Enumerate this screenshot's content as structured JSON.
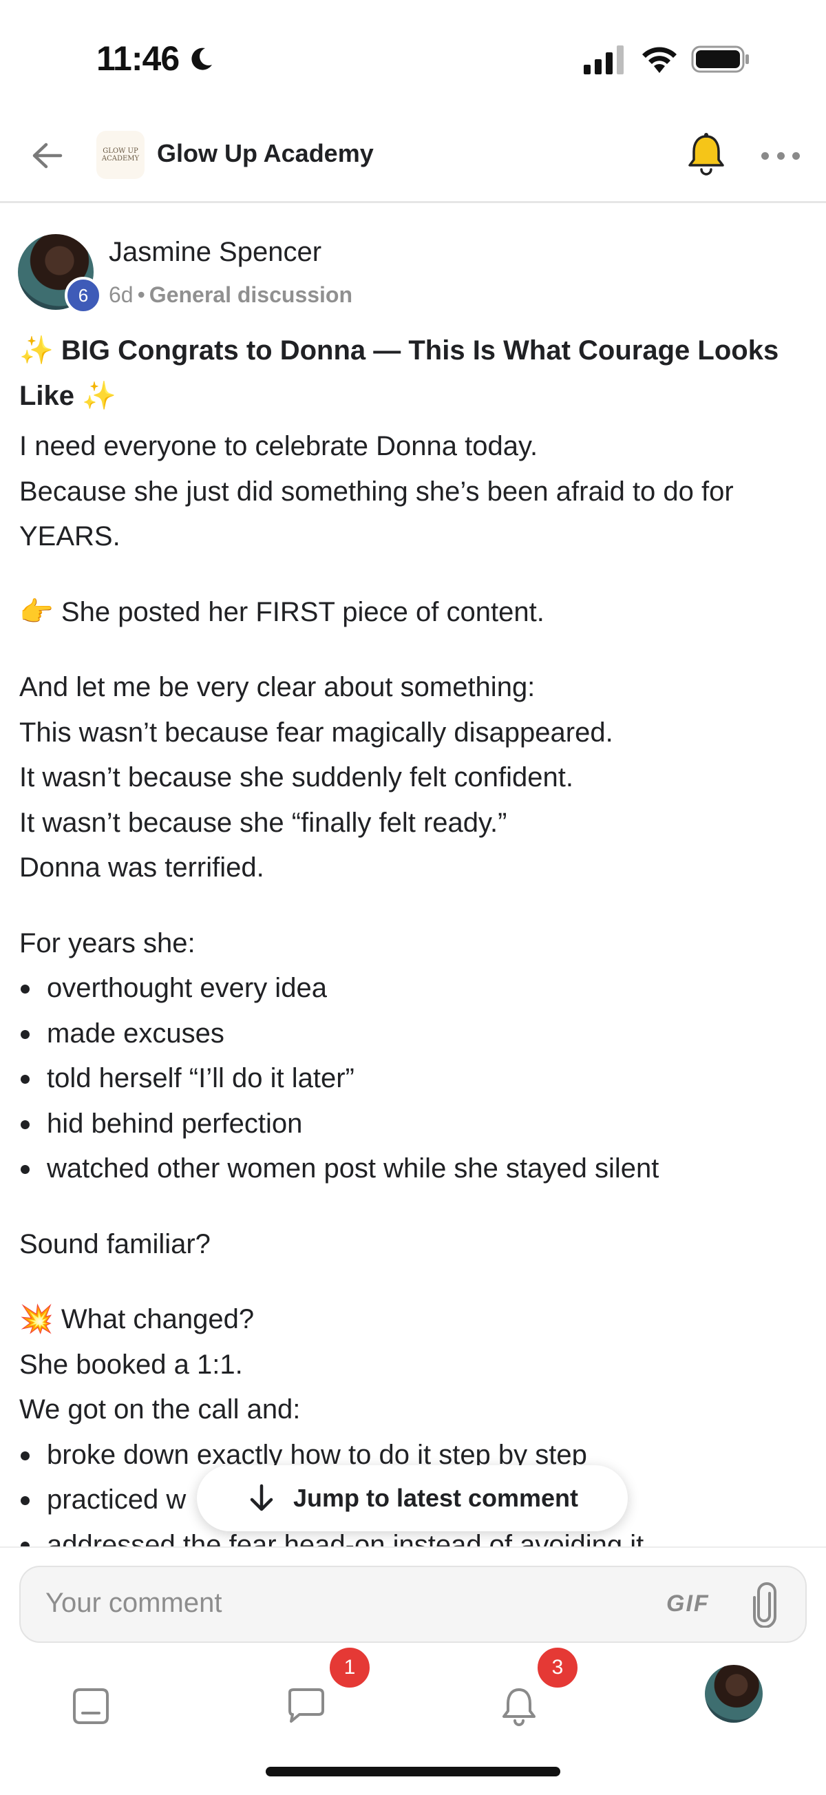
{
  "status_bar": {
    "time": "11:46"
  },
  "header": {
    "group_logo_text": "GLOW UP ACADEMY",
    "group_name": "Glow Up Academy"
  },
  "post": {
    "author": "Jasmine Spencer",
    "level": "6",
    "age": "6d",
    "separator": "•",
    "category": "General discussion",
    "title": "✨ BIG Congrats to Donna — This Is What Courage Looks Like ✨",
    "body": {
      "p1_l1": "I need everyone to celebrate Donna today.",
      "p1_l2": "Because she just did something she’s been afraid to do for YEARS.",
      "p2": "👉 She posted her FIRST piece of content.",
      "p3_l1": "And let me be very clear about something:",
      "p3_l2": "This wasn’t because fear magically disappeared.",
      "p3_l3": "It wasn’t because she suddenly felt confident.",
      "p3_l4": "It wasn’t because she “finally felt ready.”",
      "p3_l5": "Donna was terrified.",
      "p4_intro": "For years she:",
      "p4_items": [
        "overthought every idea",
        "made excuses",
        "told herself “I’ll do it later”",
        "hid behind perfection",
        "watched other women post while she stayed silent"
      ],
      "p5": "Sound familiar?",
      "p6_l1": "💥 What changed?",
      "p6_l2": "She booked a 1:1.",
      "p6_l3": "We got on the call and:",
      "p6_items": [
        "broke down exactly how to do it step by step",
        "practiced w",
        "addressed the fear head-on instead of avoiding it"
      ]
    }
  },
  "jump": {
    "label": "Jump to latest comment"
  },
  "comment": {
    "placeholder": "Your comment",
    "gif_label": "GIF"
  },
  "nav": {
    "chat_badge": "1",
    "notifications_badge": "3"
  }
}
